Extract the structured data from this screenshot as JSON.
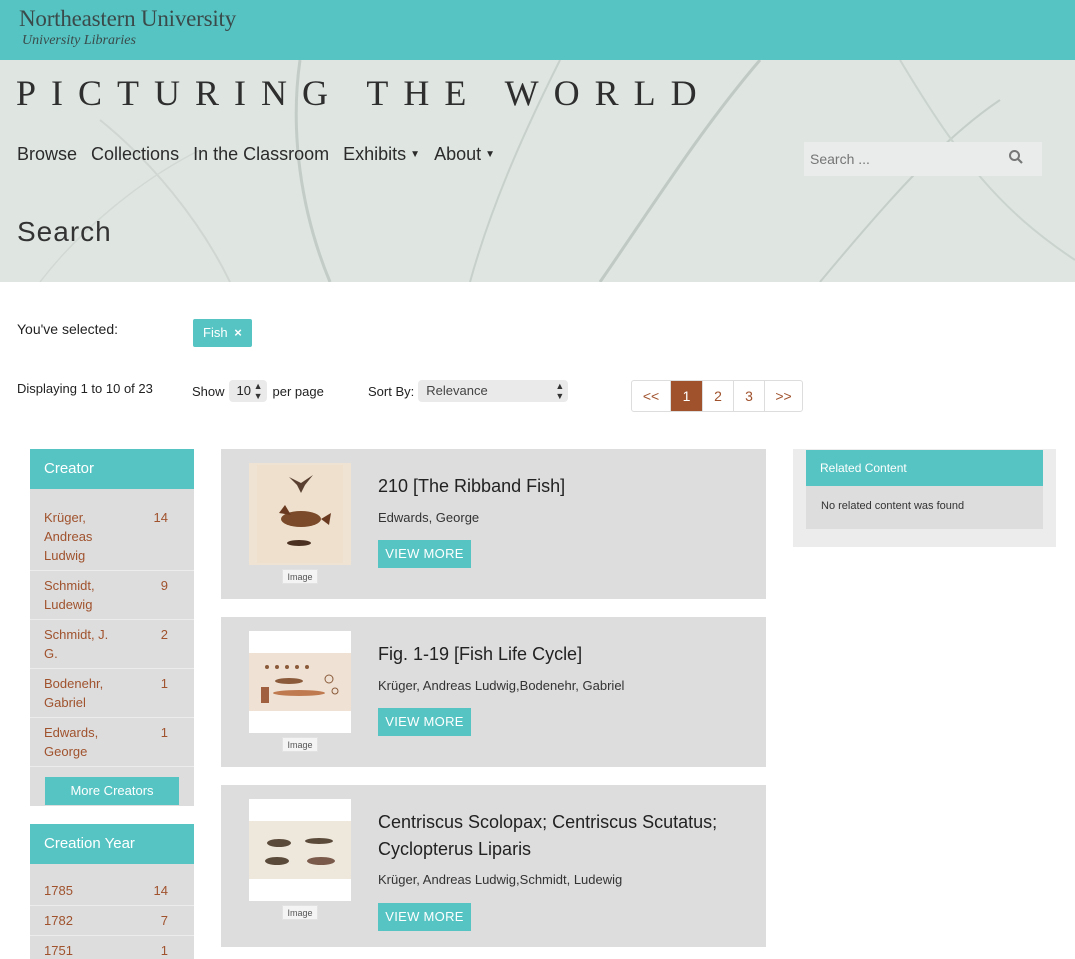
{
  "header": {
    "university": "Northeastern University",
    "libraries": "University Libraries",
    "site_title": "PICTURING THE WORLD"
  },
  "nav": {
    "items": [
      {
        "label": "Browse",
        "dropdown": false
      },
      {
        "label": "Collections",
        "dropdown": false
      },
      {
        "label": "In the Classroom",
        "dropdown": false
      },
      {
        "label": "Exhibits",
        "dropdown": true
      },
      {
        "label": "About",
        "dropdown": true
      }
    ],
    "search_placeholder": "Search ...",
    "search_icon": "magnifier-icon"
  },
  "page": {
    "heading": "Search"
  },
  "filters": {
    "label": "You've selected:",
    "chips": [
      {
        "label": "Fish",
        "remove_icon": "×"
      }
    ]
  },
  "results_info": {
    "displaying": "Displaying 1 to 10 of 23",
    "show_label": "Show",
    "per_page_value": "10",
    "per_page_label": "per page",
    "sort_label": "Sort By:",
    "sort_value": "Relevance"
  },
  "pagination": {
    "items": [
      "<<",
      "1",
      "2",
      "3",
      ">>"
    ],
    "active": "1"
  },
  "facets": [
    {
      "title": "Creator",
      "rows": [
        {
          "name": "Krüger, Andreas Ludwig",
          "count": "14"
        },
        {
          "name": "Schmidt, Ludewig",
          "count": "9"
        },
        {
          "name": "Schmidt, J. G.",
          "count": "2"
        },
        {
          "name": "Bodenehr, Gabriel",
          "count": "1"
        },
        {
          "name": "Edwards, George",
          "count": "1"
        }
      ],
      "more": "More Creators"
    },
    {
      "title": "Creation Year",
      "rows": [
        {
          "name": "1785",
          "count": "14"
        },
        {
          "name": "1782",
          "count": "7"
        },
        {
          "name": "1751",
          "count": "1"
        }
      ]
    }
  ],
  "results": [
    {
      "title": "210 [The Ribband Fish]",
      "creator": "Edwards, George",
      "type": "Image",
      "button": "VIEW MORE"
    },
    {
      "title": "Fig. 1-19 [Fish Life Cycle]",
      "creator": "Krüger, Andreas Ludwig,Bodenehr, Gabriel",
      "type": "Image",
      "button": "VIEW MORE"
    },
    {
      "title": "Centriscus Scolopax; Centriscus Scutatus; Cyclopterus Liparis",
      "creator": "Krüger, Andreas Ludwig,Schmidt, Ludewig",
      "type": "Image",
      "button": "VIEW MORE"
    }
  ],
  "related": {
    "title": "Related Content",
    "text": "No related content was found"
  },
  "colors": {
    "teal": "#56c4c3",
    "link_brown": "#a0522d",
    "panel_gray": "#dddddd"
  }
}
